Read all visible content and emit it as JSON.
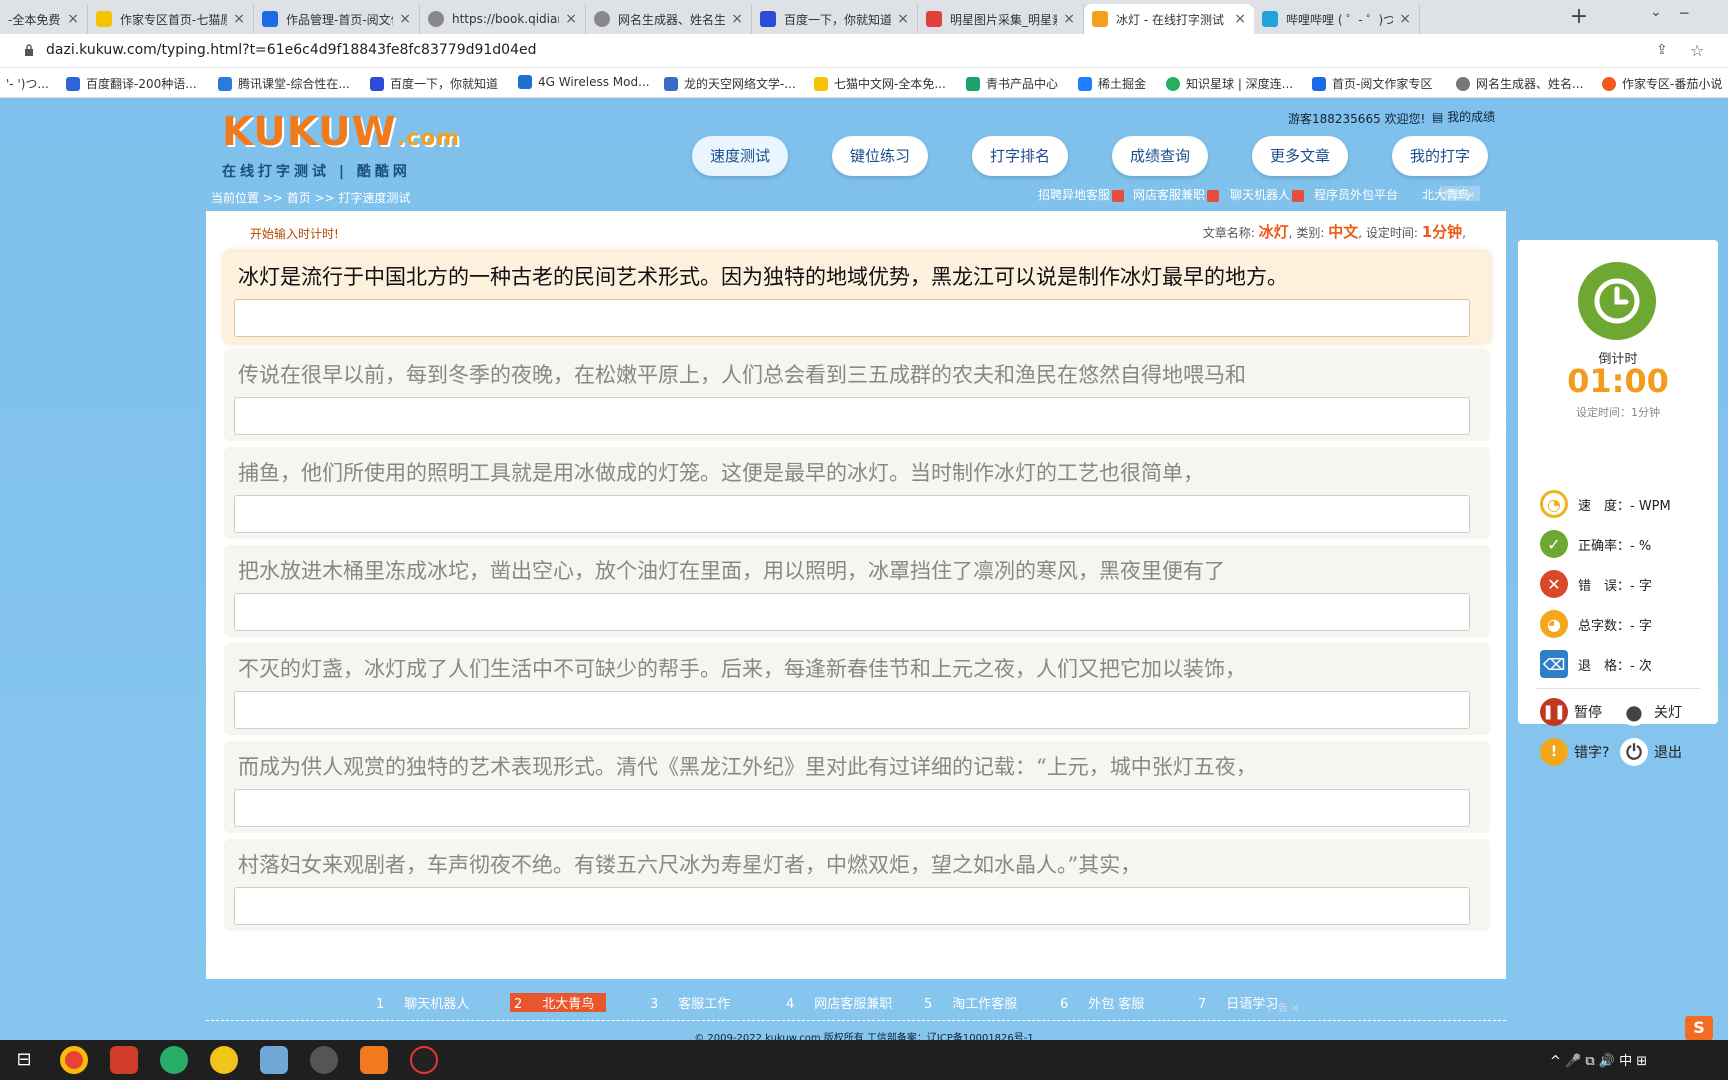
{
  "browser": {
    "tabs": [
      {
        "label": "-全本免费",
        "color": "#4a90d9"
      },
      {
        "label": "作家专区首页-七猫原",
        "color": "#111"
      },
      {
        "label": "作品管理-首页-阅文作",
        "color": "#1c6be6"
      },
      {
        "label": "https://book.qidian.c",
        "color": "#777"
      },
      {
        "label": "网名生成器、姓名生成",
        "color": "#777"
      },
      {
        "label": "百度一下，你就知道",
        "color": "#2d4bd6"
      },
      {
        "label": "明星图片采集_明星素",
        "color": "#e0403a"
      },
      {
        "label": "冰灯 - 在线打字测试",
        "color": "#f0a21d"
      },
      {
        "label": "哔哩哔哩 ( ゜- ゜)つロ",
        "color": "#22a3db"
      }
    ],
    "url": "dazi.kukuw.com/typing.html?t=61e6c4d9f18843fe8fc83779d91d04ed",
    "bookmarks": [
      {
        "label": "'- ')つ...",
        "color": "#22a3db"
      },
      {
        "label": "百度翻译-200种语...",
        "color": "#2d67d6"
      },
      {
        "label": "腾讯课堂-综合性在...",
        "color": "#2a7bde"
      },
      {
        "label": "百度一下，你就知道",
        "color": "#2d4bd6"
      },
      {
        "label": "4G Wireless Mod...",
        "color": "#1f6fd1"
      },
      {
        "label": "龙的天空网络文学-...",
        "color": "#3a6cc4"
      },
      {
        "label": "七猫中文网-全本免...",
        "color": "#111"
      },
      {
        "label": "青书产品中心",
        "color": "#1aa36b"
      },
      {
        "label": "稀土掘金",
        "color": "#1e80ff"
      },
      {
        "label": "知识星球 | 深度连...",
        "color": "#27ae60"
      },
      {
        "label": "首页-阅文作家专区",
        "color": "#1c6be6"
      },
      {
        "label": "网名生成器、姓名...",
        "color": "#777"
      },
      {
        "label": "作家专区-番茄小说",
        "color": "#f25a1d"
      }
    ]
  },
  "site": {
    "logo_text": "KUKUW",
    "logo_suffix": ".com",
    "logo_tagline": "在线打字测试 | 酷酷网",
    "welcome": "游客188235665 欢迎您!",
    "my_score": "我的成绩",
    "nav": [
      "速度测试",
      "键位练习",
      "打字排名",
      "成绩查询",
      "更多文章",
      "我的打字"
    ],
    "breadcrumb": "当前位置 >> 首页 >> 打字速度测试",
    "promos": [
      "招聘异地客服",
      "网店客服兼职",
      "聊天机器人",
      "程序员外包平台",
      "北大青鸟"
    ],
    "ad_tag": "广告"
  },
  "typing": {
    "hint": "开始输入时计时!",
    "article_label": "文章名称:",
    "article_name": "冰灯",
    "category_label": "类别:",
    "category": "中文",
    "time_label": "设定时间:",
    "time_value": "1分钟",
    "lines": [
      "冰灯是流行于中国北方的一种古老的民间艺术形式。因为独特的地域优势，黑龙江可以说是制作冰灯最早的地方。",
      "传说在很早以前，每到冬季的夜晚，在松嫩平原上，人们总会看到三五成群的农夫和渔民在悠然自得地喂马和",
      "捕鱼，他们所使用的照明工具就是用冰做成的灯笼。这便是最早的冰灯。当时制作冰灯的工艺也很简单，",
      "把水放进木桶里冻成冰坨，凿出空心，放个油灯在里面，用以照明，冰罩挡住了凛冽的寒风，黑夜里便有了",
      "不灭的灯盏，冰灯成了人们生活中不可缺少的帮手。后来，每逢新春佳节和上元之夜，人们又把它加以装饰，",
      "而成为供人观赏的独特的艺术表现形式。清代《黑龙江外纪》里对此有过详细的记载：“上元，城中张灯五夜，",
      "村落妇女来观剧者，车声彻夜不绝。有镂五六尺冰为寿星灯者，中燃双炬，望之如水晶人。”其实，"
    ]
  },
  "stats": {
    "countdown_label": "倒计时",
    "countdown": "01:00",
    "set_time": "设定时间：1分钟",
    "speed": "速　度：- WPM",
    "accuracy": "正确率：- %",
    "errors": "错　误：- 字",
    "total": "总字数：- 字",
    "backspace": "退　格：- 次",
    "pause": "暂停",
    "light_off": "关灯",
    "typo": "错字?",
    "exit": "退出"
  },
  "footer": {
    "links": [
      {
        "num": "1",
        "label": "聊天机器人"
      },
      {
        "num": "2",
        "label": "北大青鸟"
      },
      {
        "num": "3",
        "label": "客服工作"
      },
      {
        "num": "4",
        "label": "网店客服兼职"
      },
      {
        "num": "5",
        "label": "淘工作客服"
      },
      {
        "num": "6",
        "label": "外包 客服"
      },
      {
        "num": "7",
        "label": "日语学习"
      }
    ],
    "ad": "广告",
    "copyright": "© 2009-2022 kukuw.com 版权所有 工信部备案：辽ICP备10001826号-1",
    "ime": "S"
  },
  "taskbar": {
    "tray": "^ 🎤 ⧉ 🔊 中 ⊞"
  }
}
